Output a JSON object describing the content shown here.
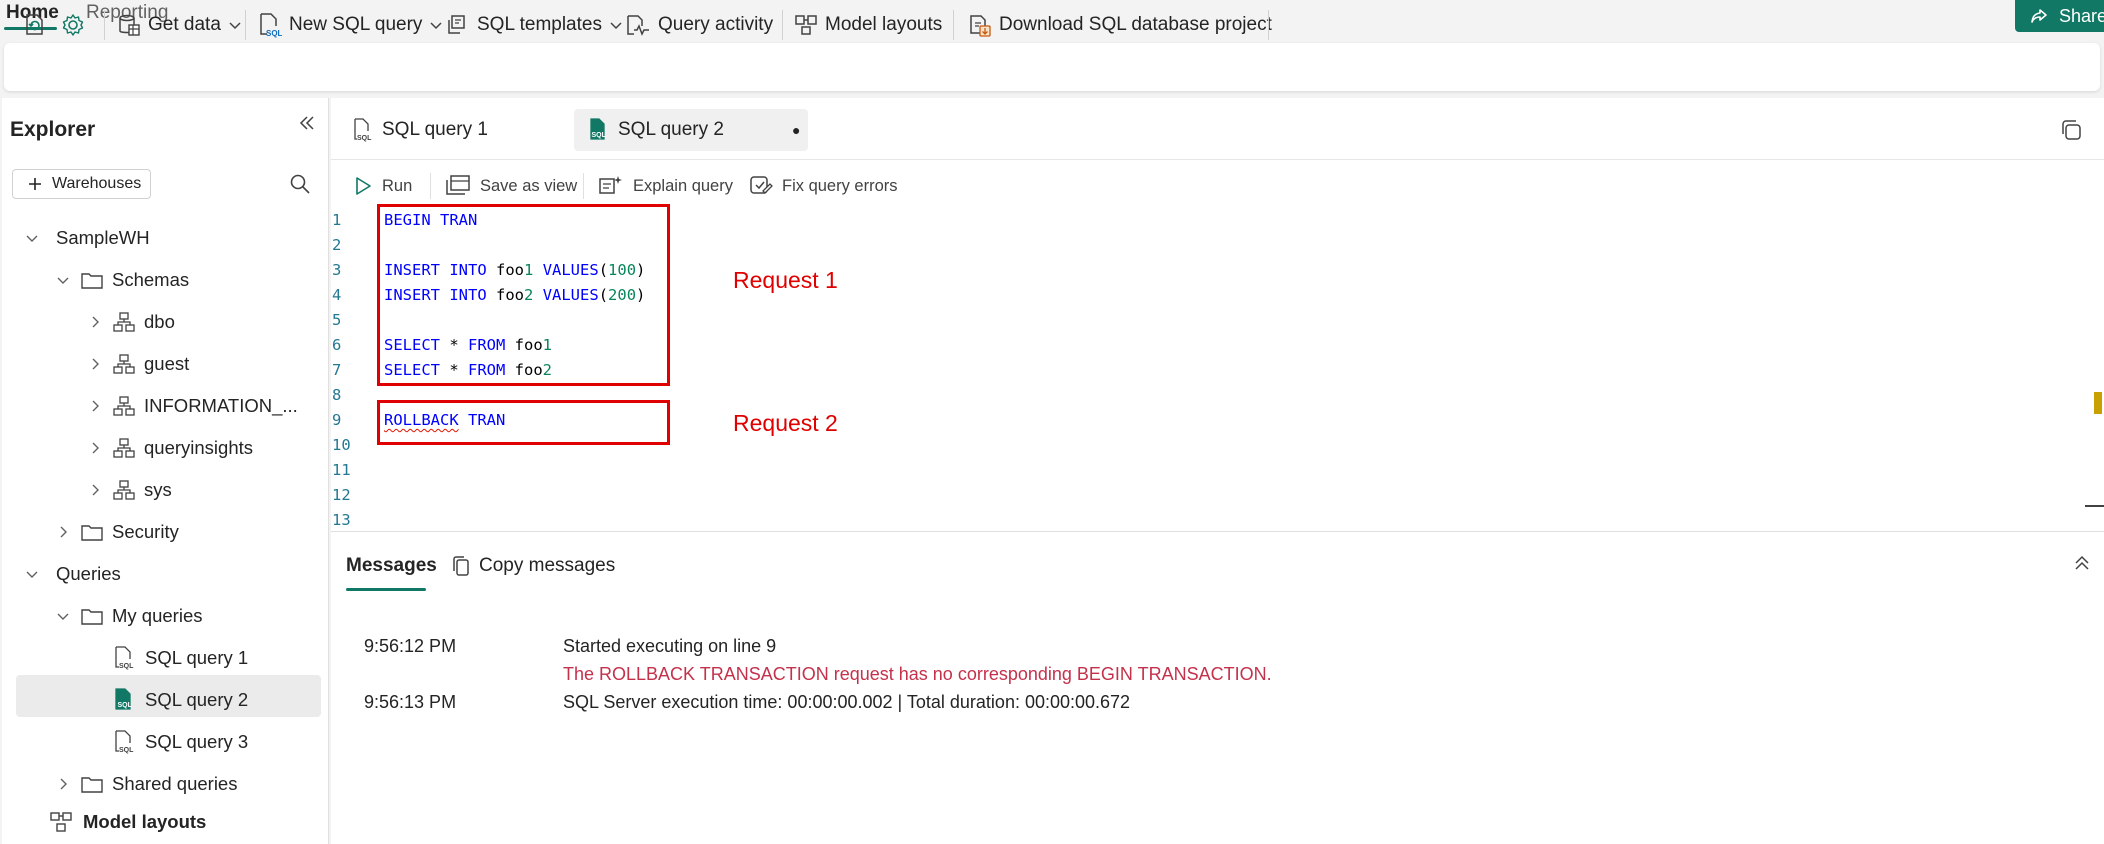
{
  "top_tabs": [
    {
      "label": "Home",
      "active": true
    },
    {
      "label": "Reporting",
      "active": false
    }
  ],
  "share": {
    "label": "Share"
  },
  "ribbon": {
    "get_data": "Get data",
    "new_sql_query": "New SQL query",
    "sql_templates": "SQL templates",
    "query_activity": "Query activity",
    "model_layouts": "Model layouts",
    "download_project": "Download SQL database project"
  },
  "explorer": {
    "title": "Explorer",
    "warehouses_button": "Warehouses",
    "tree": {
      "warehouse": "SampleWH",
      "schemas": "Schemas",
      "schema_items": [
        "dbo",
        "guest",
        "INFORMATION_...",
        "queryinsights",
        "sys"
      ],
      "security": "Security",
      "queries": "Queries",
      "my_queries": "My queries",
      "query_items": [
        "SQL query 1",
        "SQL query 2",
        "SQL query 3"
      ],
      "selected_query": "SQL query 2",
      "shared_queries": "Shared queries",
      "model_layouts": "Model layouts"
    }
  },
  "query_tabs": [
    {
      "label": "SQL query 1",
      "active": false
    },
    {
      "label": "SQL query 2",
      "active": true,
      "unsaved_marker": "●"
    }
  ],
  "editor_toolbar": {
    "run": "Run",
    "save_as_view": "Save as view",
    "explain_query": "Explain query",
    "fix_query_errors": "Fix query errors"
  },
  "code": {
    "line_numbers": [
      "1",
      "2",
      "3",
      "4",
      "5",
      "6",
      "7",
      "8",
      "9",
      "10",
      "11",
      "12",
      "13"
    ],
    "lines": [
      "BEGIN TRAN",
      "",
      "INSERT INTO foo1 VALUES(100)",
      "INSERT INTO foo2 VALUES(200)",
      "",
      "SELECT * FROM foo1",
      "SELECT * FROM foo2",
      "",
      "ROLLBACK TRAN",
      "",
      "",
      "",
      ""
    ]
  },
  "annotations": {
    "request_1": "Request 1",
    "request_2": "Request 2"
  },
  "results": {
    "messages_tab": "Messages",
    "copy_messages": "Copy messages",
    "messages": [
      {
        "time": "9:56:12 PM",
        "text": "Started executing on line 9",
        "level": "info"
      },
      {
        "time": "",
        "text": "The ROLLBACK TRANSACTION request has no corresponding BEGIN TRANSACTION.",
        "level": "error"
      },
      {
        "time": "9:56:13 PM",
        "text": "SQL Server execution time: 00:00:00.002 | Total duration: 00:00:00.672",
        "level": "info"
      }
    ]
  },
  "colors": {
    "accent": "#117865",
    "error_text": "#c4314b",
    "annotation_red": "#e00000",
    "sql_keyword": "#0000ff",
    "sql_number": "#098658",
    "line_number": "#237893"
  }
}
